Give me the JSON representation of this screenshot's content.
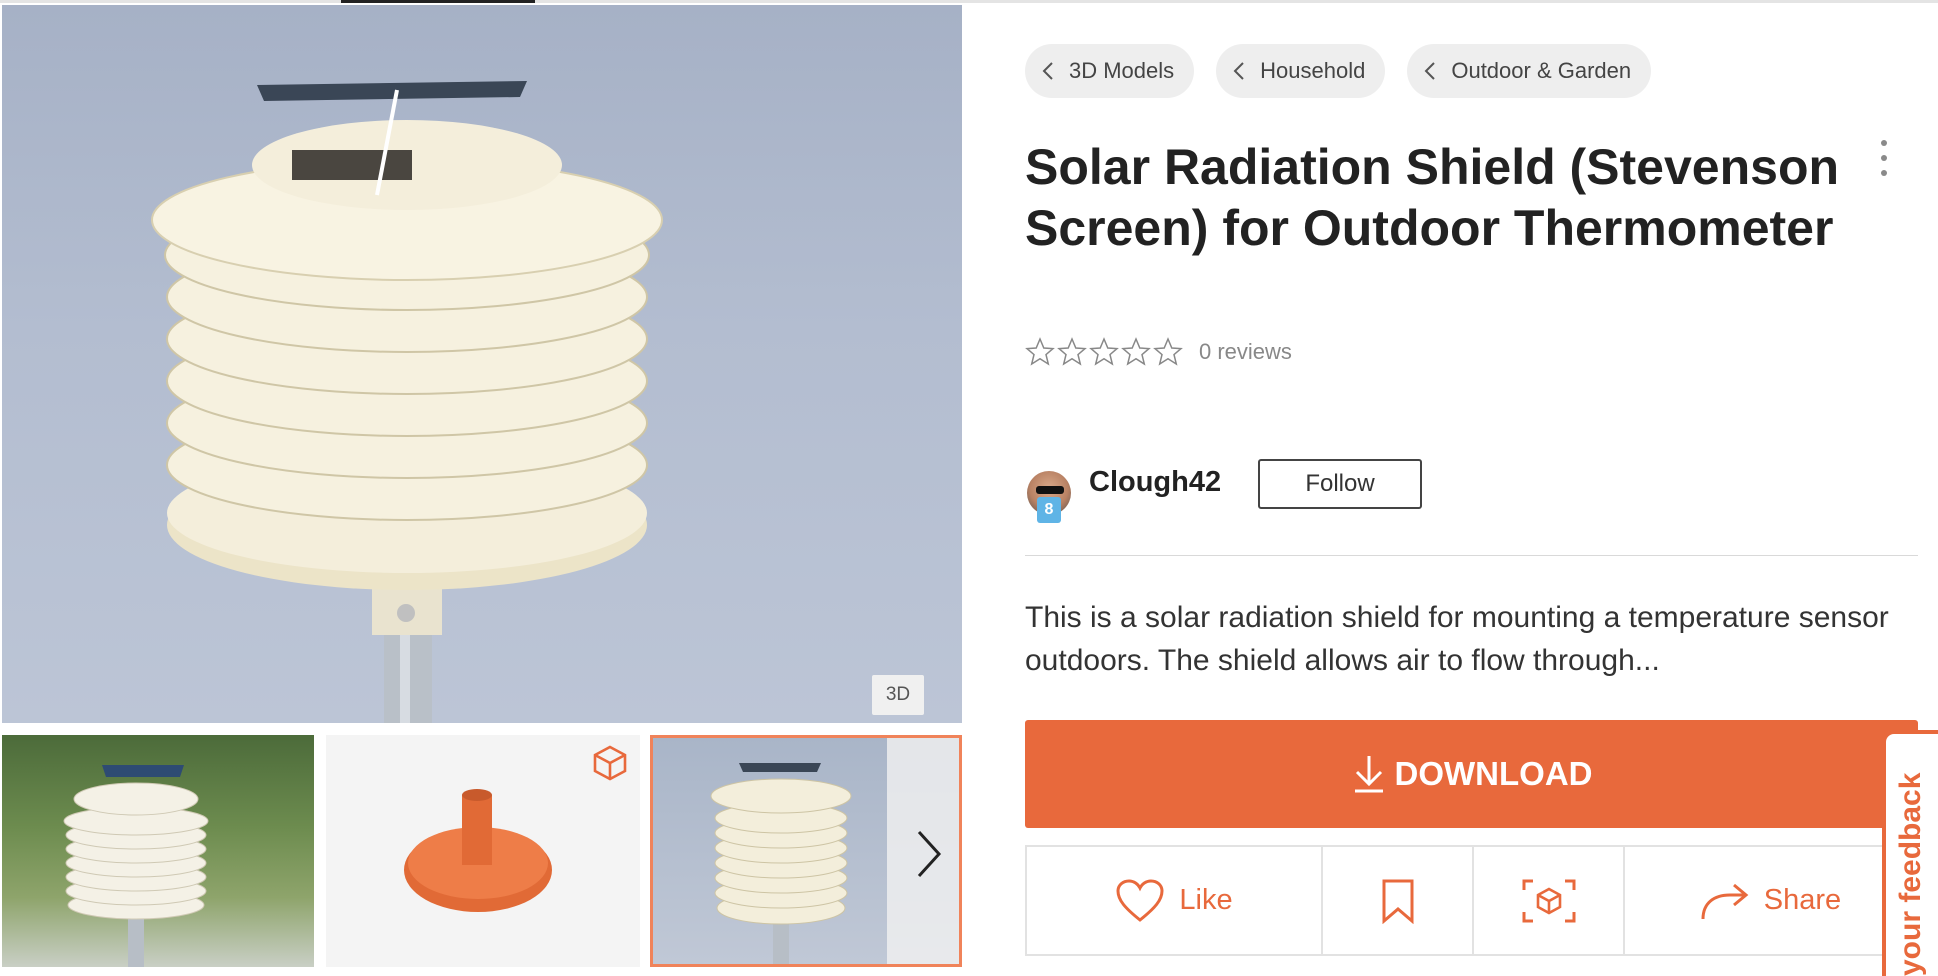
{
  "gallery": {
    "main_image_alt": "Solar radiation shield on a pole",
    "badge_3d": "3D",
    "thumbnails": [
      {
        "name": "thumb-photo-outdoor"
      },
      {
        "name": "thumb-3d-model-base"
      },
      {
        "name": "thumb-photo-closeup",
        "selected": true
      }
    ]
  },
  "breadcrumbs": [
    "3D Models",
    "Household",
    "Outdoor & Garden"
  ],
  "title": "Solar Radiation Shield (Stevenson Screen) for Outdoor Thermometer",
  "rating": {
    "stars": 0,
    "max_stars": 5,
    "reviews_text": "0 reviews"
  },
  "author": {
    "name": "Clough42",
    "level": "8",
    "follow_label": "Follow"
  },
  "description": "This is a solar radiation shield for mounting a temperature sensor outdoors. The shield allows air to flow through...",
  "download_label": "DOWNLOAD",
  "actions": {
    "like_label": "Like",
    "share_label": "Share"
  },
  "feedback_label": "your feedback",
  "colors": {
    "accent": "#e8693c",
    "level_badge": "#5fb4e6",
    "crumb_bg": "#eeeeee"
  },
  "icons": [
    "chevron-left-icon",
    "kebab-menu-icon",
    "star-outline-icon",
    "download-arrow-icon",
    "heart-icon",
    "bookmark-icon",
    "3d-view-icon",
    "share-arrow-icon",
    "cube-icon",
    "chevron-right-icon"
  ]
}
